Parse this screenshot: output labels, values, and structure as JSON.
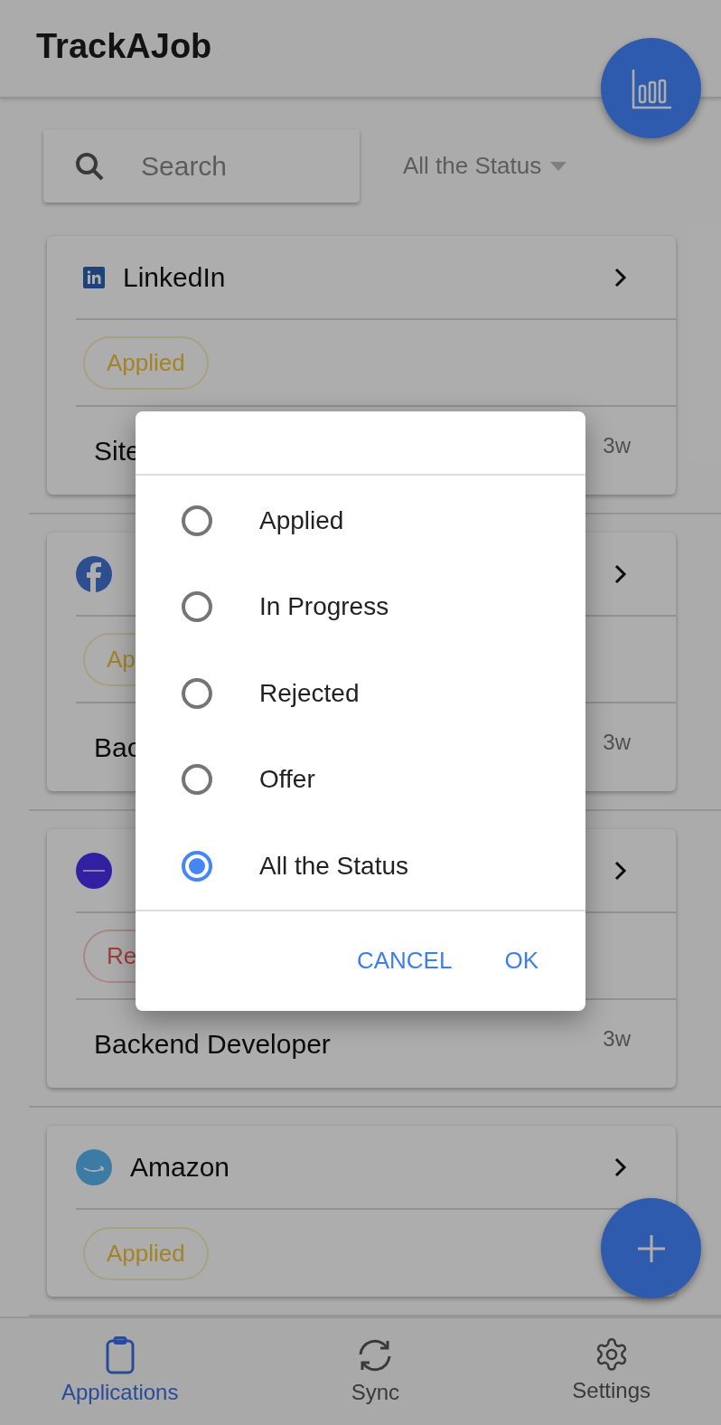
{
  "app_title": "TrackAJob",
  "search": {
    "placeholder": "Search"
  },
  "status_filter": {
    "value": "All the Status"
  },
  "applications": [
    {
      "company": "LinkedIn",
      "status": {
        "label": "Applied",
        "kind": "applied"
      },
      "position": "Site",
      "age": "3w"
    },
    {
      "status": {
        "label": "Ap",
        "kind": "applied"
      },
      "position": "Bac",
      "age": "3w"
    },
    {
      "status": {
        "label": "Re",
        "kind": "rejected"
      },
      "position": "Backend Developer",
      "age": "3w"
    },
    {
      "company": "Amazon",
      "status": {
        "label": "Applied",
        "kind": "applied"
      }
    }
  ],
  "dialog": {
    "options": [
      {
        "label": "Applied",
        "selected": false
      },
      {
        "label": "In Progress",
        "selected": false
      },
      {
        "label": "Rejected",
        "selected": false
      },
      {
        "label": "Offer",
        "selected": false
      },
      {
        "label": "All the Status",
        "selected": true
      }
    ],
    "buttons": [
      "CANCEL",
      "OK"
    ]
  },
  "bottom_nav": [
    {
      "label": "Applications",
      "selected": true
    },
    {
      "label": "Sync",
      "selected": false
    },
    {
      "label": "Settings",
      "selected": false
    }
  ]
}
